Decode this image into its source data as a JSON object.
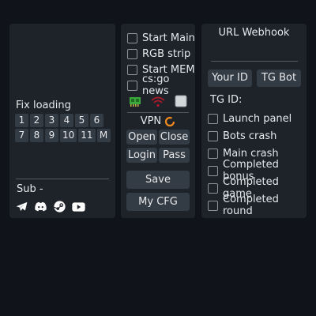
{
  "left_panel": {
    "fix_title": "Fix loading",
    "numbers_row1": [
      "1",
      "2",
      "3",
      "4",
      "5",
      "6"
    ],
    "numbers_row2": [
      "7",
      "8",
      "9",
      "10",
      "11",
      "M"
    ],
    "sub_label": "Sub -",
    "socials": [
      "telegram-icon",
      "discord-icon",
      "steam-icon",
      "youtube-icon"
    ]
  },
  "mid_panel": {
    "checkboxes": [
      "Start Main",
      "RGB strip",
      "Start MEM",
      "cs:go news"
    ],
    "icons": [
      "memory-chip-icon",
      "wifi-icon",
      "square-icon"
    ],
    "vpn_label": "VPN",
    "open_label": "Open",
    "close_label": "Close",
    "login_label": "Login",
    "pass_label": "Pass",
    "save_label": "Save",
    "mycfg_label": "My CFG"
  },
  "right_panel": {
    "url_title": "URL Webhook",
    "your_id_label": "Your ID",
    "tg_bot_label": "TG Bot",
    "tg_id_label": "TG ID:",
    "checkboxes": [
      "Launch panel",
      "Bots crash",
      "Main crash",
      "Completed bonus",
      "Completed game",
      "Completed round"
    ]
  },
  "colors": {
    "background": "#10141a",
    "panel": "#1d2329",
    "button": "#333b44",
    "vpn_accent": "#f08a1c",
    "memory_green": "#3aa83a",
    "wifi_red": "#b0182c"
  }
}
